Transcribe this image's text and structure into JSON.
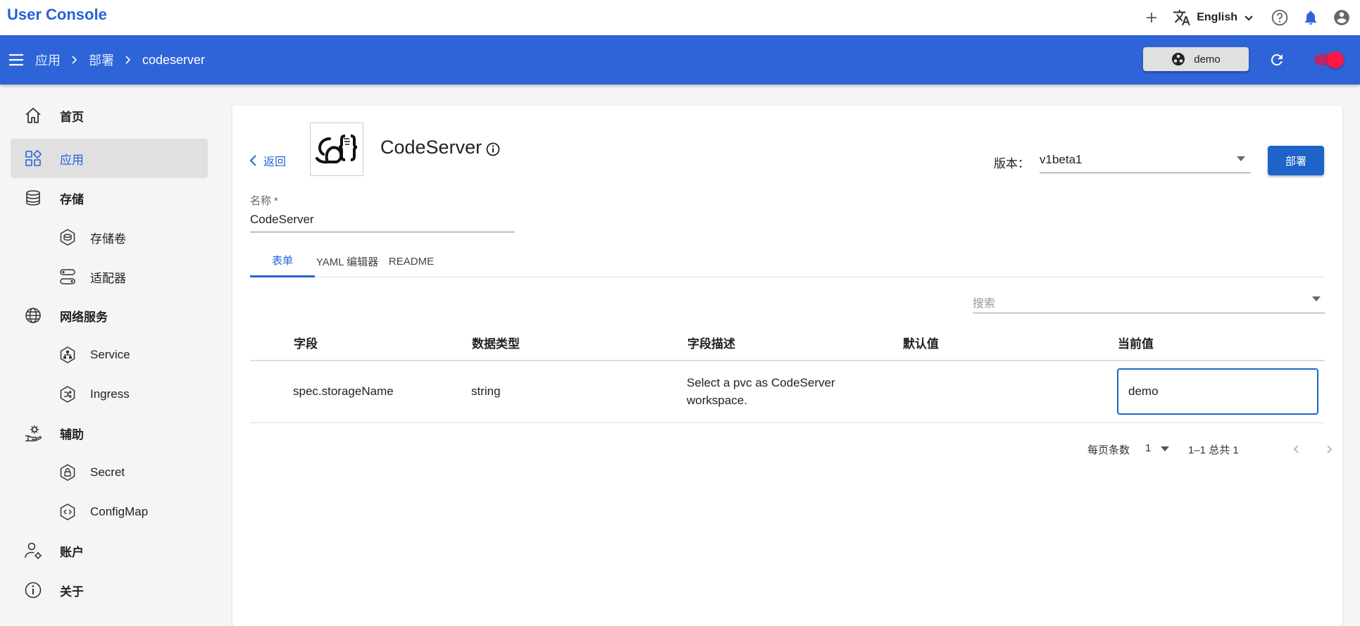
{
  "header": {
    "title": "User Console",
    "language": "English",
    "icons": [
      "add-icon",
      "translate-icon",
      "chevron-down-icon",
      "help-icon",
      "bell-icon",
      "account-icon"
    ]
  },
  "breadcrumb": {
    "items": [
      "应用",
      "部署",
      "codeserver"
    ]
  },
  "namespace": {
    "label": "demo"
  },
  "sidebar": {
    "items": [
      {
        "label": "首页",
        "icon": "home-icon"
      },
      {
        "label": "应用",
        "icon": "apps-icon"
      },
      {
        "label": "存储",
        "icon": "database-icon"
      },
      {
        "label": "存储卷",
        "icon": "volume-icon"
      },
      {
        "label": "适配器",
        "icon": "adapter-icon"
      },
      {
        "label": "网络服务",
        "icon": "globe-icon"
      },
      {
        "label": "Service",
        "icon": "service-icon"
      },
      {
        "label": "Ingress",
        "icon": "ingress-icon"
      },
      {
        "label": "辅助",
        "icon": "helper-icon"
      },
      {
        "label": "Secret",
        "icon": "secret-icon"
      },
      {
        "label": "ConfigMap",
        "icon": "configmap-icon"
      },
      {
        "label": "账户",
        "icon": "account-settings-icon"
      },
      {
        "label": "关于",
        "icon": "info-icon"
      }
    ]
  },
  "main": {
    "back_label": "返回",
    "app_name": "CodeServer",
    "version_label": "版本：",
    "version_value": "v1beta1",
    "deploy_label": "部署",
    "name_label": "名称 *",
    "name_value": "CodeServer",
    "tabs": [
      {
        "label": "表单"
      },
      {
        "label": "YAML 编辑器"
      },
      {
        "label": "README"
      }
    ],
    "search_placeholder": "搜索",
    "table": {
      "headers": [
        "字段",
        "数据类型",
        "字段描述",
        "默认值",
        "当前值"
      ],
      "rows": [
        {
          "field": "spec.storageName",
          "type": "string",
          "description_line1": "Select a pvc as CodeServer",
          "description_line2": "workspace.",
          "default": "",
          "current": "demo"
        }
      ]
    },
    "pagination": {
      "rows_per_page_label": "每页条数",
      "rows_per_page": "1",
      "range": "1–1 总共 1"
    }
  },
  "colors": {
    "primary": "#2e64d8",
    "accent": "#2563d9",
    "toggle": "#ff1744"
  }
}
